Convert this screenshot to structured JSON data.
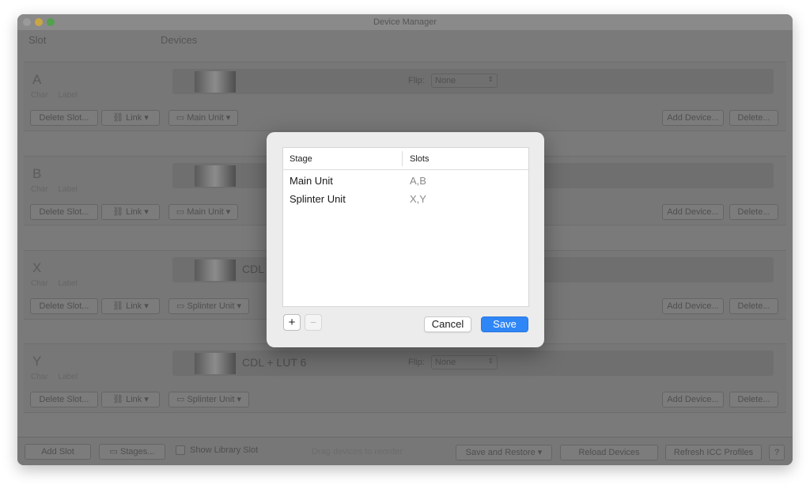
{
  "window": {
    "title": "Device Manager"
  },
  "columns": {
    "slot": "Slot",
    "devices": "Devices"
  },
  "slots": [
    {
      "letter": "A",
      "sub_char": "Char",
      "sub_label": "Label",
      "device_name": "",
      "flip_label": "Flip:",
      "flip_value": "None",
      "delete_slot": "Delete Slot...",
      "link": "Link",
      "unit": "Main Unit",
      "add_device": "Add Device...",
      "delete": "Delete..."
    },
    {
      "letter": "B",
      "sub_char": "Char",
      "sub_label": "Label",
      "device_name": "",
      "flip_label": "",
      "flip_value": "",
      "delete_slot": "Delete Slot...",
      "link": "Link",
      "unit": "Main Unit",
      "add_device": "Add Device...",
      "delete": "Delete..."
    },
    {
      "letter": "X",
      "sub_char": "Char",
      "sub_label": "Label",
      "device_name": "CDL",
      "flip_label": "",
      "flip_value": "",
      "delete_slot": "Delete Slot...",
      "link": "Link",
      "unit": "Splinter Unit",
      "add_device": "Add Device...",
      "delete": "Delete..."
    },
    {
      "letter": "Y",
      "sub_char": "Char",
      "sub_label": "Label",
      "device_name": "CDL + LUT 6",
      "flip_label": "Flip:",
      "flip_value": "None",
      "delete_slot": "Delete Slot...",
      "link": "Link",
      "unit": "Splinter Unit",
      "add_device": "Add Device...",
      "delete": "Delete..."
    }
  ],
  "footer": {
    "add_slot": "Add Slot",
    "stages": "Stages...",
    "show_library_slot": "Show Library Slot",
    "hint": "Drag devices to reorder",
    "save_restore": "Save and Restore",
    "reload_devices": "Reload Devices",
    "refresh_icc": "Refresh ICC Profiles",
    "help": "?"
  },
  "dialog": {
    "header_stage": "Stage",
    "header_slots": "Slots",
    "rows": [
      {
        "stage": "Main Unit",
        "slots": "A,B"
      },
      {
        "stage": "Splinter Unit",
        "slots": "X,Y"
      }
    ],
    "add": "+",
    "remove": "−",
    "cancel": "Cancel",
    "save": "Save"
  },
  "colors": {
    "accent": "#2f86f6",
    "dim_window": "#7a7a7a"
  }
}
